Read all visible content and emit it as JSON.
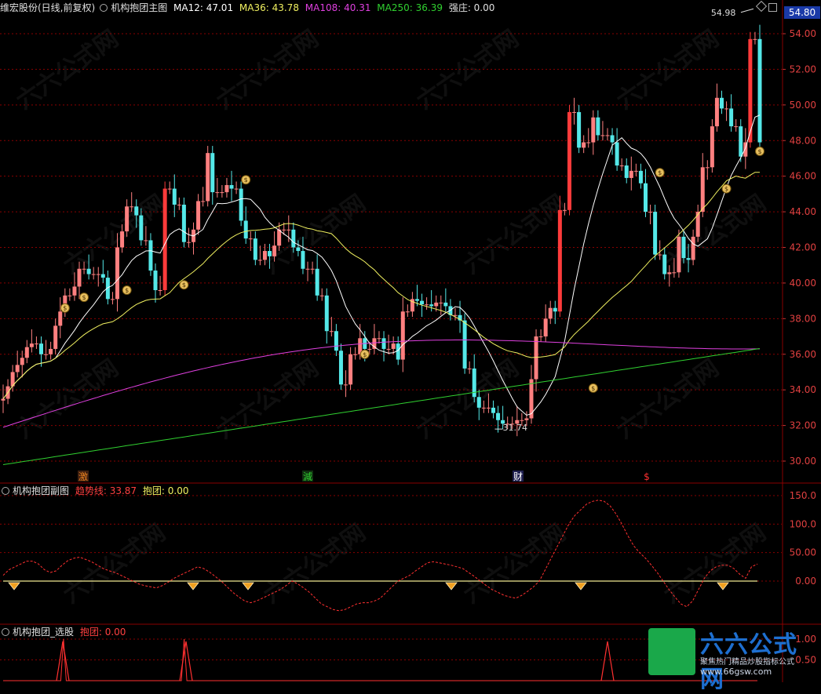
{
  "main_header": {
    "stock": "维宏股份(日线,前复权)",
    "indicator": "机构抱团主图",
    "ma12": "MA12: 47.01",
    "ma36": "MA36: 43.78",
    "ma108": "MA108: 40.31",
    "ma250": "MA250: 36.39",
    "qiangzhuang": "强庄: 0.00"
  },
  "sub_header": {
    "indicator": "机构抱团副图",
    "trend": "趋势线: 33.87",
    "baotuan": "抱团: 0.00"
  },
  "select_header": {
    "indicator": "机构抱团_选股",
    "baotuan": "抱团: 0.00"
  },
  "price_tag": "54.80",
  "annotations": {
    "high": "54.98",
    "low": "31.74"
  },
  "event_markers": [
    {
      "text": "激"
    },
    {
      "text": "減"
    },
    {
      "text": "财"
    },
    {
      "text": "$"
    }
  ],
  "price_axis": [
    "54.00",
    "52.00",
    "50.00",
    "48.00",
    "46.00",
    "44.00",
    "42.00",
    "40.00",
    "38.00",
    "36.00",
    "34.00",
    "32.00",
    "30.00"
  ],
  "sub_axis": [
    "150.0",
    "100.0",
    "50.00",
    "0.00"
  ],
  "sel_axis": [
    "1.00",
    "0.50"
  ],
  "watermark": "六六公式网",
  "logo": {
    "main": "六六公式网",
    "sub": "聚焦热门精品炒股指标公式",
    "url": "www.66gsw.com"
  },
  "colors": {
    "up": "#ff3b3b",
    "up_hollow": "#ff8080",
    "down": "#54e8e8",
    "ma12": "#ffffff",
    "ma36": "#f0f060",
    "ma108": "#e040e0",
    "ma250": "#30d030",
    "trend": "#ff3030",
    "grid": "#8a0000"
  },
  "chart_data": [
    {
      "type": "candlestick",
      "title": "机构抱团主图",
      "ylim": [
        29.2,
        55.5
      ],
      "x": [
        1,
        2,
        3,
        4,
        5,
        6,
        7,
        8,
        9,
        10,
        11,
        12,
        13,
        14,
        15,
        16,
        17,
        18,
        19,
        20,
        21,
        22,
        23,
        24,
        25,
        26,
        27,
        28,
        29,
        30,
        31,
        32,
        33,
        34,
        35,
        36,
        37,
        38,
        39,
        40,
        41,
        42,
        43,
        44,
        45,
        46,
        47,
        48,
        49,
        50,
        51,
        52,
        53,
        54,
        55,
        56,
        57,
        58,
        59,
        60,
        61,
        62,
        63,
        64,
        65,
        66,
        67,
        68,
        69,
        70,
        71,
        72,
        73,
        74,
        75,
        76,
        77,
        78,
        79,
        80,
        81,
        82,
        83,
        84,
        85,
        86,
        87,
        88,
        89,
        90,
        91,
        92,
        93,
        94,
        95,
        96,
        97,
        98,
        99,
        100,
        101,
        102,
        103,
        104,
        105,
        106,
        107,
        108,
        109,
        110,
        111,
        112,
        113,
        114,
        115,
        116,
        117,
        118,
        119,
        120,
        121,
        122,
        123,
        124,
        125,
        126,
        127,
        128,
        129,
        130,
        131,
        132,
        133,
        134,
        135,
        136,
        137,
        138,
        139,
        140,
        141,
        142,
        143,
        144,
        145,
        146,
        147,
        148,
        149,
        150,
        151,
        152,
        153,
        154,
        155,
        156,
        157,
        158,
        159,
        160
      ],
      "open": [
        33.4,
        33.5,
        34.2,
        35.0,
        35.4,
        35.8,
        36.4,
        36.6,
        36.6,
        36.0,
        36.0,
        36.3,
        37.6,
        38.4,
        39.3,
        39.3,
        39.8,
        40.8,
        40.8,
        40.5,
        40.5,
        40.5,
        40.3,
        39.1,
        39.1,
        42.0,
        42.9,
        44.3,
        44.3,
        43.8,
        42.4,
        42.4,
        40.7,
        39.6,
        39.6,
        45.3,
        45.3,
        44.4,
        44.4,
        42.3,
        42.3,
        43.0,
        44.6,
        44.6,
        47.3,
        45.1,
        45.1,
        45.1,
        45.5,
        45.3,
        45.3,
        43.5,
        42.5,
        42.5,
        41.3,
        41.3,
        41.8,
        41.5,
        42.1,
        43.0,
        43.0,
        43.0,
        42.0,
        41.8,
        40.8,
        40.8,
        40.8,
        39.3,
        39.3,
        37.3,
        37.3,
        36.2,
        34.3,
        34.3,
        36.0,
        36.0,
        36.9,
        36.3,
        36.3,
        36.9,
        36.9,
        36.3,
        36.3,
        36.6,
        35.7,
        38.4,
        38.4,
        39.1,
        39.0,
        38.8,
        38.8,
        38.7,
        38.9,
        38.9,
        38.7,
        38.2,
        38.2,
        37.9,
        35.2,
        35.2,
        33.6,
        33.0,
        33.0,
        33.0,
        32.7,
        32.3,
        32.1,
        32.1,
        32.1,
        32.3,
        32.3,
        32.4,
        34.6,
        37.0,
        37.0,
        38.0,
        38.6,
        38.4,
        44.1,
        44.1,
        49.6,
        49.6,
        47.6,
        47.9,
        47.9,
        49.3,
        48.3,
        48.3,
        48.3,
        47.9,
        46.6,
        46.6,
        45.9,
        46.3,
        46.3,
        45.6,
        44.0,
        44.0,
        41.6,
        41.6,
        40.5,
        40.6,
        40.6,
        42.6,
        41.4,
        41.3,
        42.6,
        44.0,
        46.5,
        46.5,
        48.8,
        50.4,
        49.8,
        49.8,
        48.8,
        48.8,
        47.1,
        47.9,
        53.7,
        53.7
      ],
      "close": [
        33.5,
        34.2,
        35.0,
        35.4,
        35.8,
        36.4,
        36.6,
        36.6,
        36.0,
        36.0,
        36.3,
        37.6,
        38.4,
        39.3,
        39.3,
        39.8,
        40.8,
        40.8,
        40.5,
        40.5,
        40.5,
        40.3,
        39.1,
        39.1,
        42.0,
        42.9,
        44.3,
        44.3,
        43.8,
        42.4,
        42.4,
        40.7,
        39.6,
        39.6,
        45.3,
        45.3,
        44.4,
        44.4,
        42.3,
        42.3,
        43.0,
        44.6,
        44.6,
        47.3,
        45.1,
        45.1,
        45.1,
        45.5,
        45.3,
        45.3,
        43.5,
        42.5,
        42.5,
        41.3,
        41.3,
        41.8,
        41.5,
        42.1,
        43.0,
        43.0,
        43.0,
        42.0,
        41.8,
        40.8,
        40.8,
        40.8,
        39.3,
        39.3,
        37.3,
        37.3,
        36.2,
        34.3,
        34.3,
        36.0,
        36.0,
        36.9,
        36.3,
        36.3,
        36.9,
        36.9,
        36.3,
        36.3,
        36.6,
        35.7,
        38.4,
        38.4,
        39.1,
        39.0,
        38.8,
        38.8,
        38.7,
        38.9,
        38.9,
        38.7,
        38.2,
        38.2,
        37.9,
        35.2,
        35.2,
        33.6,
        33.0,
        33.0,
        33.0,
        32.7,
        32.3,
        32.1,
        32.1,
        32.1,
        32.3,
        32.3,
        32.4,
        34.6,
        37.0,
        37.0,
        38.0,
        38.6,
        38.4,
        44.1,
        44.1,
        49.6,
        49.6,
        47.6,
        47.9,
        47.9,
        49.3,
        48.3,
        48.3,
        48.3,
        47.9,
        46.6,
        46.6,
        45.9,
        46.3,
        46.3,
        45.6,
        44.0,
        44.0,
        41.6,
        41.6,
        40.5,
        40.6,
        40.6,
        42.6,
        41.4,
        41.3,
        42.6,
        44.0,
        46.5,
        46.5,
        48.8,
        50.4,
        49.8,
        49.8,
        48.8,
        48.8,
        47.1,
        47.9,
        53.7,
        53.7,
        47.9
      ],
      "annotations": [
        {
          "text": "54.98"
        },
        {
          "text": "31.74"
        }
      ]
    },
    {
      "type": "line",
      "title": "机构抱团副图",
      "ylim": [
        -120,
        160
      ],
      "series": [
        {
          "name": "趋势线",
          "values": [
            10,
            20,
            25,
            30,
            35,
            35,
            30,
            20,
            15,
            18,
            28,
            36,
            40,
            42,
            38,
            34,
            28,
            22,
            18,
            15,
            10,
            5,
            0,
            -5,
            -8,
            -10,
            -12,
            -8,
            -2,
            5,
            10,
            15,
            20,
            25,
            22,
            16,
            8,
            0,
            -10,
            -20,
            -28,
            -35,
            -38,
            -35,
            -30,
            -25,
            -20,
            -15,
            -8,
            0,
            -5,
            -12,
            -20,
            -30,
            -40,
            -45,
            -50,
            -52,
            -50,
            -45,
            -40,
            -38,
            -38,
            -35,
            -30,
            -20,
            -10,
            0,
            5,
            10,
            18,
            25,
            32,
            34,
            32,
            30,
            28,
            25,
            22,
            15,
            8,
            0,
            -8,
            -15,
            -20,
            -25,
            -28,
            -30,
            -25,
            -18,
            -10,
            0,
            20,
            40,
            60,
            80,
            100,
            115,
            125,
            135,
            140,
            142,
            140,
            132,
            118,
            100,
            80,
            62,
            50,
            40,
            28,
            15,
            0,
            -15,
            -28,
            -40,
            -45,
            -35,
            -15,
            5,
            18,
            25,
            28,
            28,
            22,
            12,
            5,
            25,
            30
          ]
        }
      ]
    },
    {
      "type": "line",
      "title": "机构抱团_选股",
      "ylim": [
        0,
        1.3
      ],
      "series": [
        {
          "name": "抱团",
          "values": [
            0,
            0,
            0,
            0,
            0,
            0,
            0,
            0,
            0,
            0,
            0,
            0,
            0,
            0,
            0,
            0,
            0,
            0,
            0,
            0,
            0,
            0,
            1,
            0,
            0,
            0,
            0,
            0,
            0,
            0,
            0,
            0,
            0,
            0,
            0,
            0,
            0,
            0,
            0,
            0,
            0,
            0,
            0,
            0,
            0,
            0,
            0,
            0,
            0,
            0,
            0,
            0,
            0,
            0,
            0,
            0,
            0,
            0,
            0,
            0,
            0,
            0,
            0,
            0,
            0,
            0,
            1,
            0,
            0,
            0,
            0,
            0,
            0,
            0,
            0,
            0,
            0,
            0,
            0,
            0,
            0,
            0,
            0,
            0,
            0,
            0,
            0,
            0,
            0,
            0,
            0,
            0,
            0,
            0,
            0,
            0,
            0,
            0,
            0,
            0,
            0,
            0,
            0,
            0,
            0,
            0,
            0,
            0,
            0,
            0,
            0,
            0,
            0,
            0,
            0,
            0,
            0,
            0,
            0,
            0,
            0,
            0,
            0,
            0,
            0,
            0,
            0,
            0,
            0,
            0,
            0,
            0,
            0,
            0,
            0,
            0,
            0,
            0,
            0,
            0,
            0,
            0,
            0,
            0,
            0,
            0,
            0,
            0,
            0,
            0,
            0,
            0,
            0,
            0,
            0,
            0,
            0,
            0,
            0,
            0,
            0,
            0,
            0,
            0,
            0,
            0,
            0,
            0,
            0,
            0,
            0,
            0,
            0,
            0,
            0,
            0,
            0,
            0,
            0,
            0,
            0,
            0,
            0,
            0,
            0,
            0,
            0,
            0,
            0,
            0,
            0,
            0,
            0,
            0,
            0,
            0,
            0,
            0,
            0,
            0,
            0,
            0,
            0,
            0,
            0,
            0,
            0,
            0,
            0,
            0,
            0,
            0,
            0,
            0,
            0,
            0,
            0,
            0,
            0,
            0,
            0,
            0,
            0,
            0,
            0,
            0,
            0,
            0,
            0,
            0,
            0,
            0,
            0,
            0,
            0,
            0,
            0,
            0,
            0,
            0,
            0,
            0,
            0,
            0,
            0,
            0,
            0,
            0,
            0,
            0,
            0,
            0,
            0,
            0,
            0,
            0,
            0,
            0,
            0,
            0,
            0,
            0,
            0,
            0,
            0,
            0,
            0,
            0,
            0,
            0,
            0,
            0,
            0,
            0,
            0,
            0
          ]
        }
      ]
    }
  ]
}
